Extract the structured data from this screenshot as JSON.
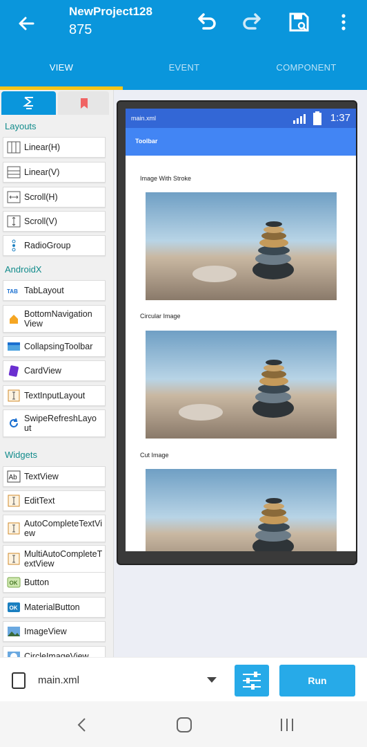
{
  "appbar": {
    "title": "NewProject128",
    "subtitle": "875"
  },
  "tabs": [
    {
      "label": "VIEW"
    },
    {
      "label": "EVENT"
    },
    {
      "label": "COMPONENT"
    }
  ],
  "palette": {
    "sections": {
      "layouts": "Layouts",
      "androidx": "AndroidX",
      "widgets": "Widgets"
    },
    "items": [
      {
        "label": "Linear(H)",
        "icon": "linear-horizontal-icon"
      },
      {
        "label": "Linear(V)",
        "icon": "linear-vertical-icon"
      },
      {
        "label": "Scroll(H)",
        "icon": "scroll-horizontal-icon"
      },
      {
        "label": "Scroll(V)",
        "icon": "scroll-vertical-icon"
      },
      {
        "label": "RadioGroup",
        "icon": "radiogroup-icon"
      },
      {
        "label": "TabLayout",
        "icon": "tablayout-icon"
      },
      {
        "label": "BottomNavigation View",
        "icon": "bottomnav-icon"
      },
      {
        "label": "CollapsingToolbar",
        "icon": "collapsing-toolbar-icon"
      },
      {
        "label": "CardView",
        "icon": "cardview-icon"
      },
      {
        "label": "TextInputLayout",
        "icon": "textinputlayout-icon"
      },
      {
        "label": "SwipeRefreshLayo ut",
        "icon": "swiperefresh-icon"
      },
      {
        "label": "TextView",
        "icon": "textview-icon"
      },
      {
        "label": "EditText",
        "icon": "edittext-icon"
      },
      {
        "label": "AutoCompleteTextVi ew",
        "icon": "autocomplete-icon"
      },
      {
        "label": "MultiAutoCompleteT extView",
        "icon": "multiautocomplete-icon"
      },
      {
        "label": "Button",
        "icon": "button-icon"
      },
      {
        "label": "MaterialButton",
        "icon": "materialbutton-icon"
      },
      {
        "label": "ImageView",
        "icon": "imageview-icon"
      },
      {
        "label": "CircleImageView",
        "icon": "circleimageview-icon"
      }
    ]
  },
  "preview": {
    "status_file": "main.xml",
    "status_time": "1:37",
    "toolbar_title": "Toolbar",
    "captions": {
      "stroke": "Image With Stroke",
      "circular": "Circular Image",
      "cut": "Cut Image"
    }
  },
  "bottom": {
    "file": "main.xml",
    "run_label": "Run"
  },
  "colors": {
    "primary": "#0a96dc",
    "indicator": "#f5c518",
    "run": "#27aae8",
    "section": "#118b8b"
  }
}
